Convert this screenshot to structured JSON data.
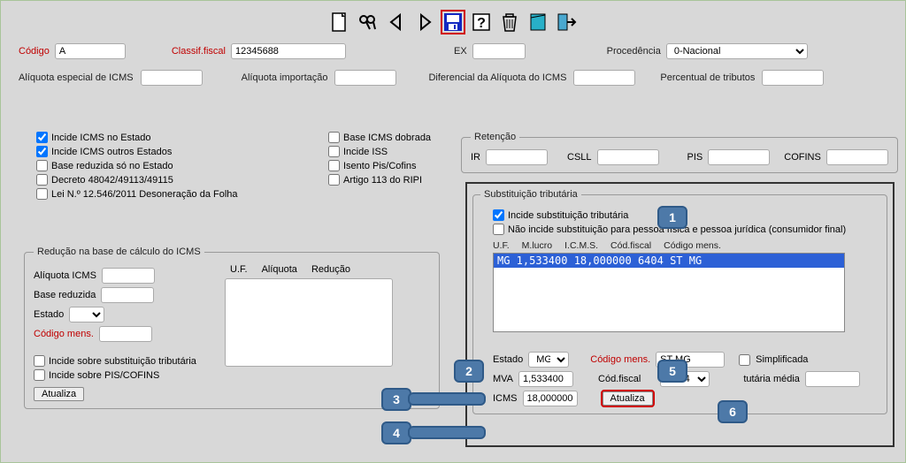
{
  "fields": {
    "codigo_label": "Código",
    "codigo_value": "A",
    "classif_label": "Classif.fiscal",
    "classif_value": "12345688",
    "ex_label": "EX",
    "ex_value": "",
    "proced_label": "Procedência",
    "proced_value": "0-Nacional",
    "aliq_esp_label": "Alíquota especial de ICMS",
    "aliq_imp_label": "Alíquota importação",
    "dif_aliq_label": "Diferencial da Alíquota do ICMS",
    "perc_trib_label": "Percentual de tributos"
  },
  "checks_left": [
    {
      "label": "Incide ICMS no Estado",
      "checked": true
    },
    {
      "label": "Incide ICMS outros Estados",
      "checked": true
    },
    {
      "label": "Base reduzida só no Estado",
      "checked": false
    },
    {
      "label": "Decreto 48042/49113/49115",
      "checked": false
    },
    {
      "label": "Lei N.º 12.546/2011 Desoneração da Folha",
      "checked": false
    }
  ],
  "checks_mid": [
    {
      "label": "Base ICMS dobrada",
      "checked": false
    },
    {
      "label": "Incide ISS",
      "checked": false
    },
    {
      "label": "Isento Pis/Cofins",
      "checked": false
    },
    {
      "label": "Artigo 113 do RIPI",
      "checked": false
    }
  ],
  "reducao": {
    "legend": "Redução na base de cálculo do ICMS",
    "aliq_label": "Alíquota ICMS",
    "base_label": "Base reduzida",
    "estado_label": "Estado",
    "codmens_label": "Código mens.",
    "hdr_uf": "U.F.",
    "hdr_aliq": "Alíquota",
    "hdr_red": "Redução",
    "ck_sub": "Incide sobre substituição tributária",
    "ck_pis": "Incide sobre PIS/COFINS",
    "btn": "Atualiza"
  },
  "retencao": {
    "legend": "Retenção",
    "ir": "IR",
    "csll": "CSLL",
    "pis": "PIS",
    "cofins": "COFINS"
  },
  "subtrib": {
    "legend": "Substituição tributária",
    "ck_incide": "Incide substituição tributária",
    "ck_naoincide": "Não incide substituição para pessoa física e pessoa jurídica (consumidor final)",
    "hdr_uf": "U.F.",
    "hdr_mlucro": "M.lucro",
    "hdr_icms": "I.C.M.S.",
    "hdr_codfiscal": "Cód.fiscal",
    "hdr_codmens": "Código mens.",
    "list_selected": "MG 1,533400 18,000000 6404 ST MG",
    "estado_label": "Estado",
    "estado_value": "MG",
    "codmens_label": "Código mens.",
    "codmens_value": "ST MG",
    "mva_label": "MVA",
    "mva_value": "1,533400",
    "codfiscal_label": "Cód.fiscal",
    "codfiscal_value": "6404",
    "icms_label": "ICMS",
    "icms_value": "18,000000",
    "simpl_label": "Simplificada",
    "tribmedia_label": "tutária média",
    "btn": "Atualiza"
  },
  "bubbles": {
    "b1": "1",
    "b2": "2",
    "b3": "3",
    "b4": "4",
    "b5": "5",
    "b6": "6"
  }
}
